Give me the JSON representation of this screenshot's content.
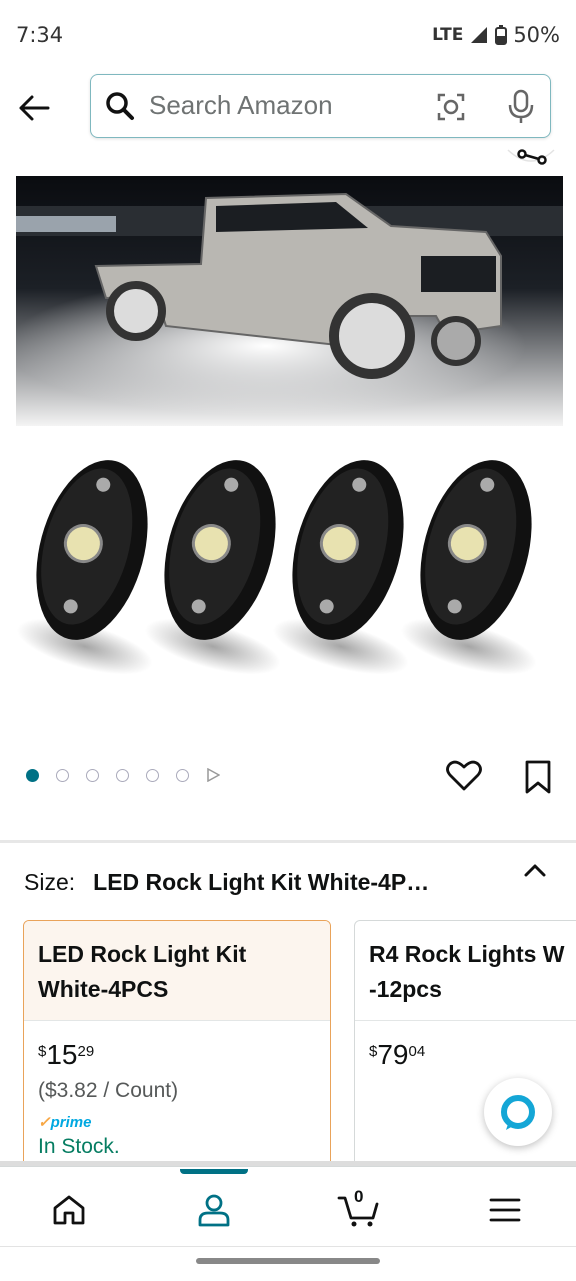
{
  "status_bar": {
    "time": "7:34",
    "network": "LTE",
    "battery": "50%"
  },
  "search": {
    "placeholder": "Search Amazon"
  },
  "gallery": {
    "image_count": 6,
    "active_index": 0
  },
  "size_selector": {
    "label": "Size:",
    "selected_value": "LED Rock Light Kit White-4P…",
    "options": [
      {
        "title": "LED Rock Light Kit White-4PCS",
        "price_symbol": "$",
        "price_whole": "15",
        "price_fraction": "29",
        "unit_price": "($3.82 / Count)",
        "prime": "prime",
        "stock": "In Stock."
      },
      {
        "title": "R4 Rock Lights W -12pcs",
        "price_symbol": "$",
        "price_whole": "79",
        "price_fraction": "04"
      }
    ]
  },
  "bottom_nav": {
    "cart_count": "0",
    "items": [
      "home-icon",
      "account-icon",
      "cart-icon",
      "menu-icon"
    ]
  },
  "colors": {
    "accent": "#007185",
    "selected_border": "#e9a35a",
    "in_stock": "#067d62",
    "prime": "#00a8e1"
  }
}
